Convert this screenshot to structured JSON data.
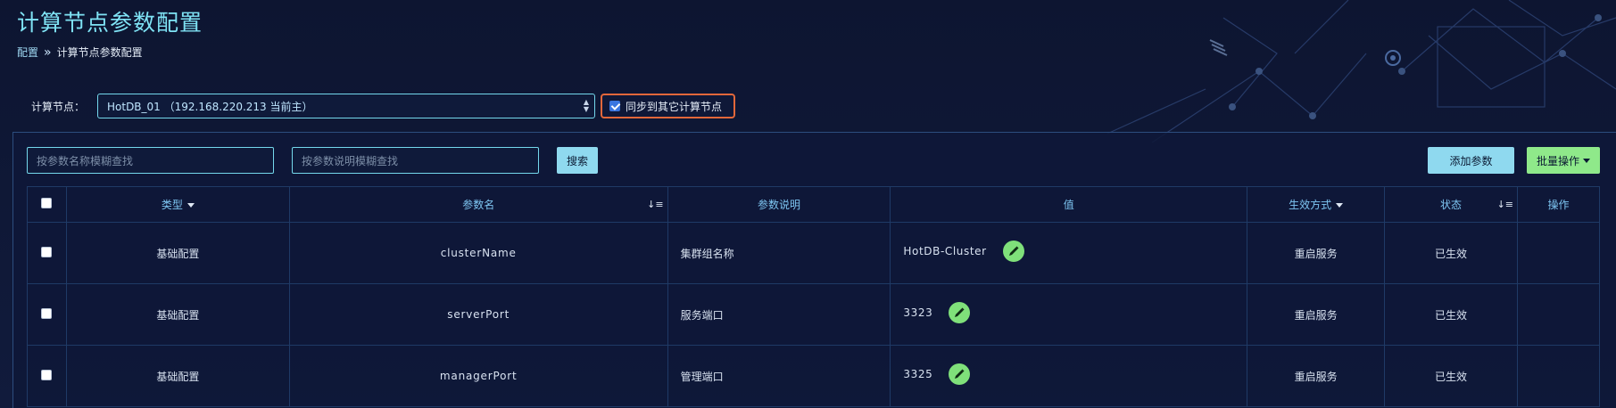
{
  "page": {
    "title": "计算节点参数配置",
    "breadcrumb": [
      "配置",
      "计算节点参数配置"
    ]
  },
  "node": {
    "label": "计算节点：",
    "selected": "HotDB_01 （192.168.220.213 当前主）",
    "sync_label": "同步到其它计算节点",
    "sync_checked": true
  },
  "toolbar": {
    "name_search_placeholder": "按参数名称模糊查找",
    "desc_search_placeholder": "按参数说明模糊查找",
    "search_label": "搜索",
    "add_label": "添加参数",
    "batch_label": "批量操作"
  },
  "table": {
    "headers": {
      "type": "类型",
      "name": "参数名",
      "desc": "参数说明",
      "value": "值",
      "mode": "生效方式",
      "status": "状态",
      "action": "操作"
    },
    "rows": [
      {
        "type": "基础配置",
        "name": "clusterName",
        "desc": "集群组名称",
        "value": "HotDB-Cluster",
        "mode": "重启服务",
        "status": "已生效"
      },
      {
        "type": "基础配置",
        "name": "serverPort",
        "desc": "服务端口",
        "value": "3323",
        "mode": "重启服务",
        "status": "已生效"
      },
      {
        "type": "基础配置",
        "name": "managerPort",
        "desc": "管理端口",
        "value": "3325",
        "mode": "重启服务",
        "status": "已生效"
      }
    ]
  },
  "colors": {
    "title": "#7fe3f5",
    "accent_button": "#8fd9ef",
    "batch_button": "#8fe98a",
    "highlight_border": "#e2673a",
    "edit_icon_bg": "#7fe07a"
  }
}
